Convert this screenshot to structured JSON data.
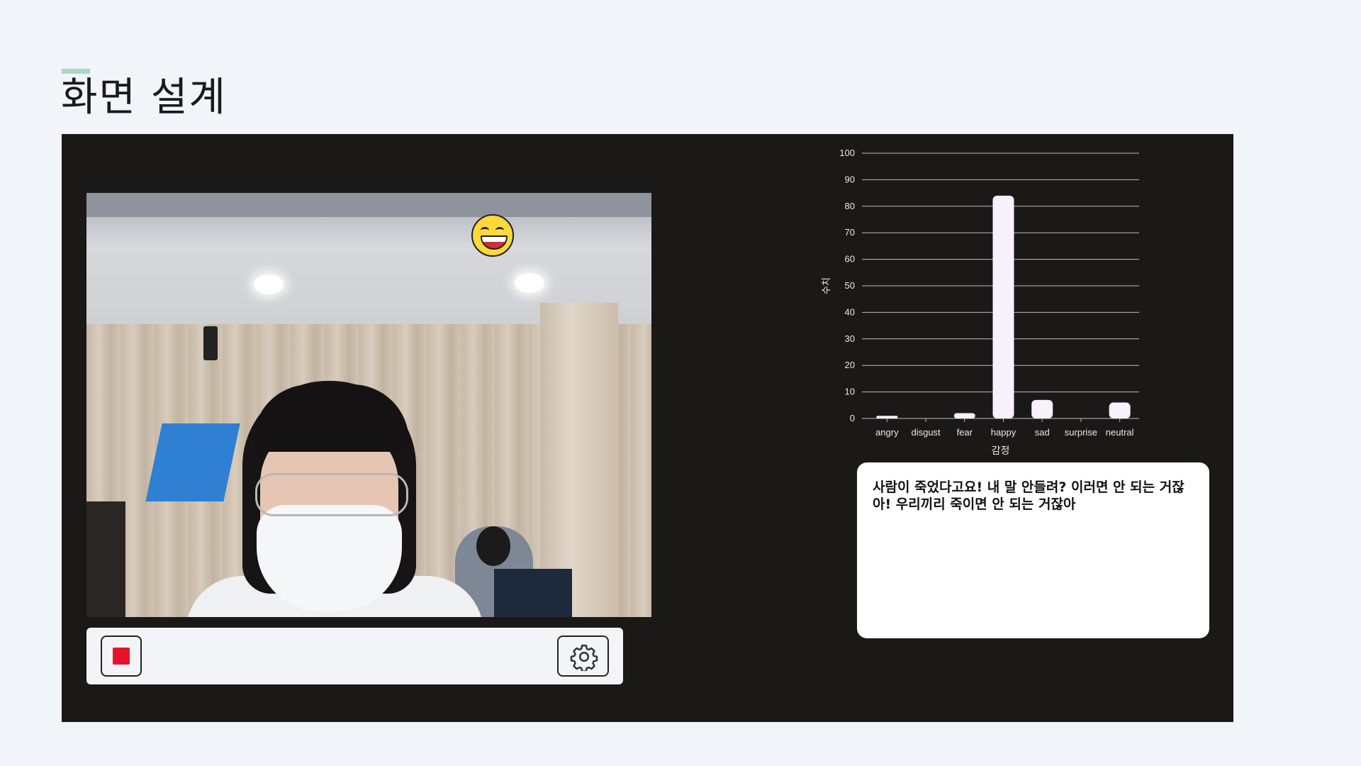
{
  "page": {
    "title": "화면 설계"
  },
  "controls": {
    "stop_label": "",
    "settings_label": ""
  },
  "emotion_icon": "grinning-face-icon",
  "subtitle": {
    "text": "사람이 죽었다고요! 내 말 안들려? 이러면 안 되는 거잖아! 우리끼리 죽이면 안 되는 거잖아"
  },
  "colors": {
    "background": "#f1f4f8",
    "panel": "#1b1818",
    "bar": "#f7f1fb",
    "stop": "#e8112d",
    "title_accent": "#a9d8c4"
  },
  "chart_data": {
    "type": "bar",
    "categories": [
      "angry",
      "disgust",
      "fear",
      "happy",
      "sad",
      "surprise",
      "neutral"
    ],
    "values": [
      1,
      0,
      2,
      84,
      7,
      0,
      6
    ],
    "xlabel": "감정",
    "ylabel": "수치",
    "ylim": [
      0,
      100
    ],
    "yticks": [
      0,
      10,
      20,
      30,
      40,
      50,
      60,
      70,
      80,
      90,
      100
    ],
    "grid": true
  }
}
